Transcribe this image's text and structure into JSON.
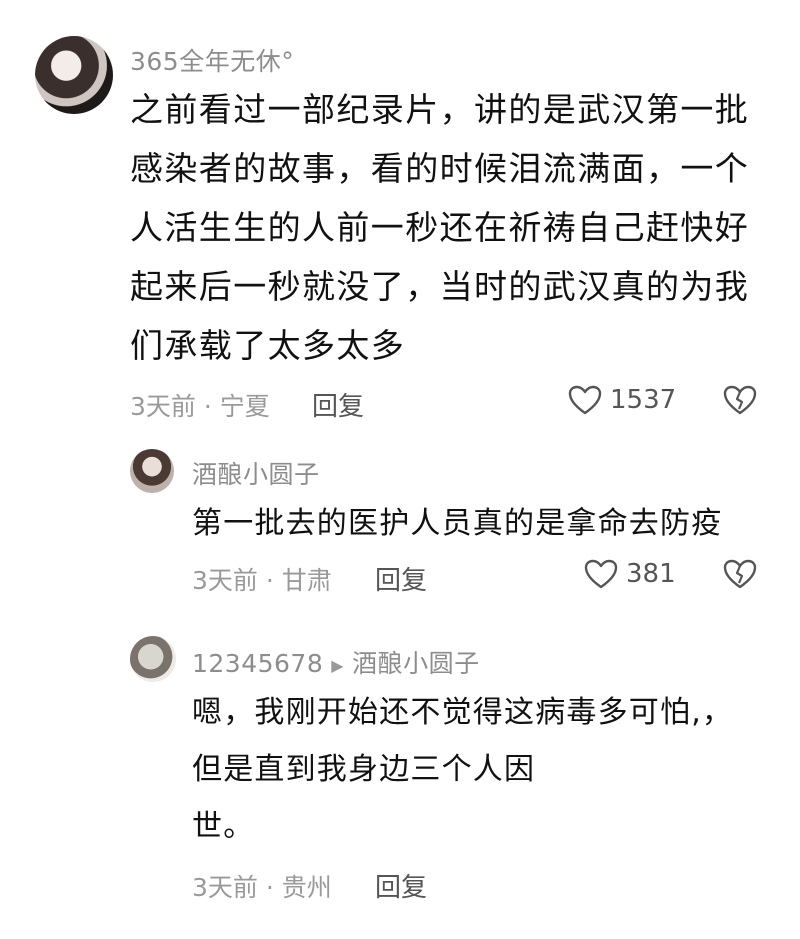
{
  "comments": [
    {
      "username": "365全年无休°",
      "text": "之前看过一部纪录片，讲的是武汉第一批感染者的故事，看的时候泪流满面，一个人活生生的人前一秒还在祈祷自己赶快好起来后一秒就没了，当时的武汉真的为我们承载了太多太多",
      "meta": "3天前 · 宁夏",
      "reply_label": "回复",
      "likes": "1537"
    },
    {
      "username": "酒酿小圆子",
      "text": "第一批去的医护人员真的是拿命去防疫",
      "meta": "3天前 · 甘肃",
      "reply_label": "回复",
      "likes": "381"
    },
    {
      "username": "12345678",
      "reply_to": "酒酿小圆子",
      "text_lines": [
        "嗯，我刚开始还不觉得这病毒多可怕,，",
        "但是直到我身边三个人因",
        "世。"
      ],
      "meta": "3天前 · 贵州",
      "reply_label": "回复"
    }
  ]
}
